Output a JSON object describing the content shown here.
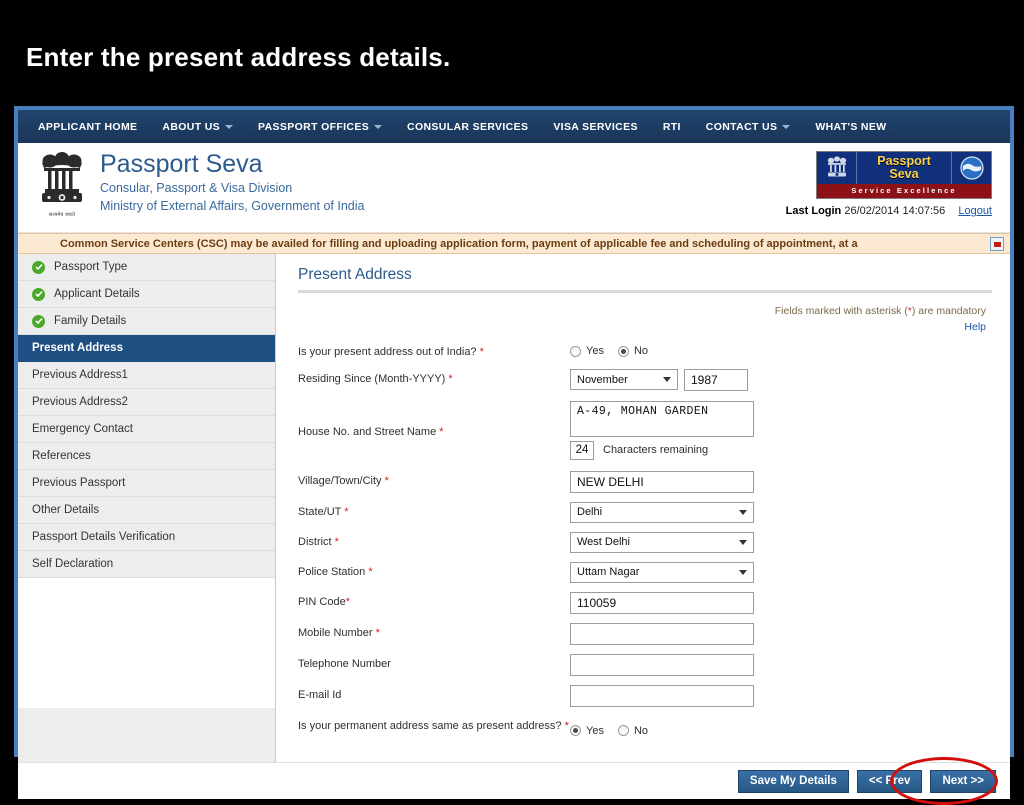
{
  "slide": {
    "title": "Enter the present address details."
  },
  "nav": {
    "items": [
      {
        "label": "APPLICANT HOME",
        "caret": false
      },
      {
        "label": "ABOUT US",
        "caret": true
      },
      {
        "label": "PASSPORT OFFICES",
        "caret": true
      },
      {
        "label": "CONSULAR SERVICES",
        "caret": false
      },
      {
        "label": "VISA SERVICES",
        "caret": false
      },
      {
        "label": "RTI",
        "caret": false
      },
      {
        "label": "CONTACT US",
        "caret": true
      },
      {
        "label": "WHAT'S NEW",
        "caret": false
      }
    ]
  },
  "header": {
    "emblem_caption": "सत्यमेव जयते",
    "brand_title": "Passport Seva",
    "brand_sub1": "Consular, Passport & Visa Division",
    "brand_sub2": "Ministry of External Affairs, Government of India",
    "badge_line1": "Passport",
    "badge_line2": "Seva",
    "badge_tagline": "Service Excellence",
    "last_login_label": "Last Login",
    "last_login_value": "26/02/2014 14:07:56",
    "logout_label": "Logout"
  },
  "notice": {
    "text": "Common Service Centers (CSC) may be availed for filling and uploading application form, payment of applicable fee and scheduling of appointment, at a",
    "stop_icon": "stop-marquee-icon"
  },
  "sidebar": {
    "items": [
      {
        "label": "Passport Type",
        "state": "done"
      },
      {
        "label": "Applicant Details",
        "state": "done"
      },
      {
        "label": "Family Details",
        "state": "done"
      },
      {
        "label": "Present Address",
        "state": "active"
      },
      {
        "label": "Previous Address1",
        "state": "plain"
      },
      {
        "label": "Previous Address2",
        "state": "plain"
      },
      {
        "label": "Emergency Contact",
        "state": "plain"
      },
      {
        "label": "References",
        "state": "plain"
      },
      {
        "label": "Previous Passport",
        "state": "plain"
      },
      {
        "label": "Other Details",
        "state": "plain"
      },
      {
        "label": "Passport Details Verification",
        "state": "plain"
      },
      {
        "label": "Self Declaration",
        "state": "plain"
      }
    ]
  },
  "form": {
    "title": "Present Address",
    "mandatory_note_pre": "Fields marked with asterisk (",
    "mandatory_note_ast": "*",
    "mandatory_note_post": ") are mandatory",
    "help_label": "Help",
    "out_of_india": {
      "label": "Is your present address out of India?",
      "required": "*",
      "yes_label": "Yes",
      "no_label": "No",
      "selected": "No"
    },
    "residing_since": {
      "label": "Residing Since (Month-YYYY)",
      "required": "*",
      "month_value": "November",
      "year_value": "1987"
    },
    "house_street": {
      "label": "House No. and Street Name",
      "required": "*",
      "value": "A-49, MOHAN GARDEN",
      "chars_remaining": "24",
      "chars_label": "Characters remaining"
    },
    "village": {
      "label": "Village/Town/City",
      "required": "*",
      "value": "NEW DELHI"
    },
    "state_ut": {
      "label": "State/UT",
      "required": "*",
      "value": "Delhi"
    },
    "district": {
      "label": "District",
      "required": "*",
      "value": "West Delhi"
    },
    "police_station": {
      "label": "Police Station",
      "required": "*",
      "value": "Uttam Nagar"
    },
    "pin_code": {
      "label": "PIN Code",
      "required": "*",
      "value": "110059"
    },
    "mobile": {
      "label": "Mobile Number",
      "required": "*",
      "value": ""
    },
    "telephone": {
      "label": "Telephone Number",
      "required": "",
      "value": ""
    },
    "email": {
      "label": "E-mail Id",
      "required": "",
      "value": ""
    },
    "permanent_same": {
      "label": "Is your permanent address same as present address?",
      "required": "*",
      "yes_label": "Yes",
      "no_label": "No",
      "selected": "Yes"
    }
  },
  "footer": {
    "save_label": "Save My Details",
    "prev_label": "<< Prev",
    "next_label": "Next >>",
    "highlight_color": "#d40d0d",
    "highlighted_button": "Next >>"
  }
}
